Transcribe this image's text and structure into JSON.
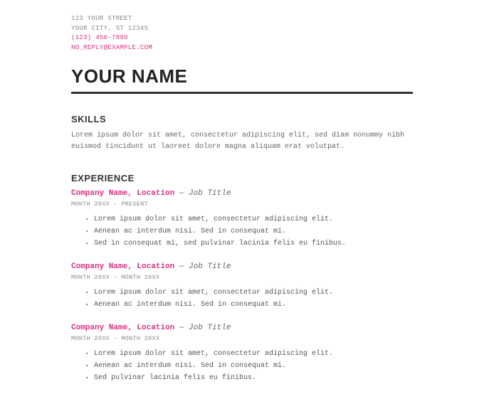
{
  "contact": {
    "street": "123 YOUR STREET",
    "city_line": "YOUR CITY, ST 12345",
    "phone": "(123) 456-7890",
    "email": "NO_REPLY@EXAMPLE.COM"
  },
  "name": "YOUR NAME",
  "skills": {
    "heading": "SKILLS",
    "body": "Lorem ipsum dolor sit amet, consectetur adipiscing elit, sed diam nonummy nibh euismod tincidunt ut laoreet dolore magna aliquam erat volutpat."
  },
  "experience": {
    "heading": "EXPERIENCE",
    "jobs": [
      {
        "company": "Company Name, Location",
        "dash": " — ",
        "title": "Job Title",
        "dates": "MONTH 20XX - PRESENT",
        "bullets": [
          "Lorem ipsum dolor sit amet, consectetur adipiscing elit.",
          "Aenean ac interdum nisi. Sed in consequat mi.",
          "Sed in consequat mi, sed pulvinar lacinia felis eu finibus."
        ]
      },
      {
        "company": "Company Name, Location",
        "dash": " — ",
        "title": "Job Title",
        "dates": "MONTH 20XX - MONTH 20XX",
        "bullets": [
          "Lorem ipsum dolor sit amet, consectetur adipiscing elit.",
          "Aenean ac interdum nisi. Sed in consequat mi."
        ]
      },
      {
        "company": "Company Name, Location",
        "dash": " — ",
        "title": "Job Title",
        "dates": "MONTH 20XX - MONTH 20XX",
        "bullets": [
          "Lorem ipsum dolor sit amet, consectetur adipiscing elit.",
          "Aenean ac interdum nisi. Sed in consequat mi.",
          "Sed pulvinar lacinia felis eu finibus."
        ]
      }
    ]
  }
}
